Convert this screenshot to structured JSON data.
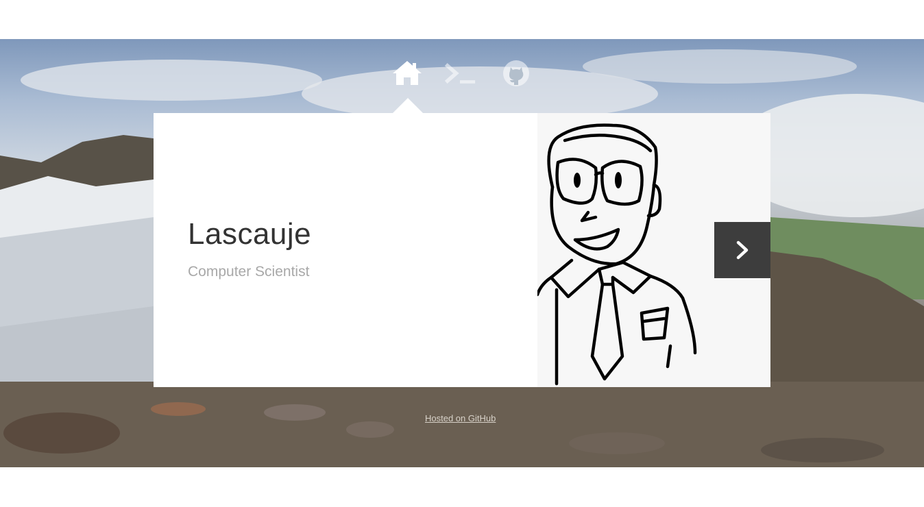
{
  "nav": {
    "items": [
      {
        "icon": "home-icon",
        "active": true
      },
      {
        "icon": "terminal-icon",
        "active": false
      },
      {
        "icon": "github-icon",
        "active": false
      }
    ]
  },
  "card": {
    "name": "Lascauje",
    "title": "Computer Scientist",
    "next_icon": "chevron-right-icon"
  },
  "footer": {
    "link_text": "Hosted on GitHub"
  },
  "colors": {
    "card_bg": "#ffffff",
    "name_text": "#333333",
    "subtitle_text": "#a8a8a8",
    "next_button_bg": "#3d3d3d",
    "active_icon": "#ffffff",
    "inactive_icon": "rgba(255,255,255,0.55)"
  }
}
